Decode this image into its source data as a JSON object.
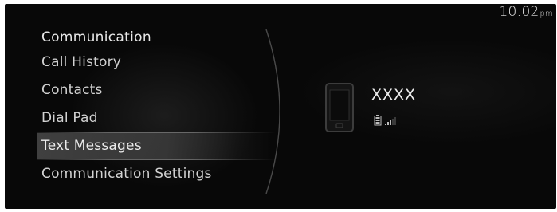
{
  "status_bar": {
    "time": "10:02",
    "ampm": "pm"
  },
  "menu": {
    "title": "Communication",
    "items": [
      {
        "label": "Call History",
        "selected": false
      },
      {
        "label": "Contacts",
        "selected": false
      },
      {
        "label": "Dial Pad",
        "selected": false
      },
      {
        "label": "Text Messages",
        "selected": true
      },
      {
        "label": "Communication Settings",
        "selected": false
      }
    ]
  },
  "device": {
    "name": "XXXX",
    "icons": [
      "phone-icon",
      "battery-icon",
      "signal-icon"
    ],
    "signal_bars_lit": 3,
    "signal_bars_total": 5
  },
  "colors": {
    "background": "#080808",
    "text": "#d2d2d2",
    "selection": "#464646"
  }
}
